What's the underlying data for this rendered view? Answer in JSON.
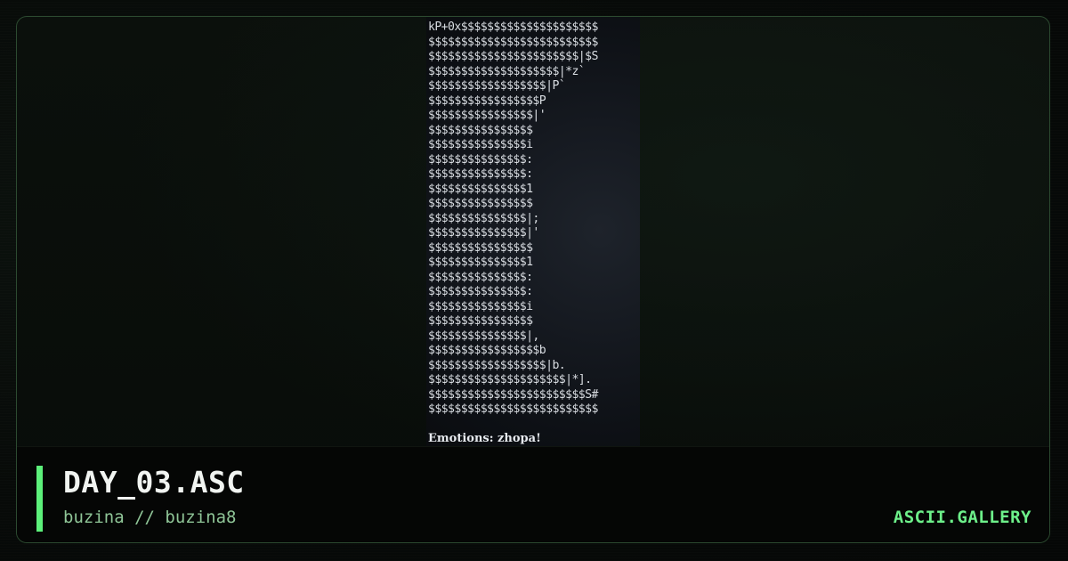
{
  "artwork": {
    "lines": [
      "kP+0x$$$$$$$$$$$$$$$$$$$$$",
      "$$$$$$$$$$$$$$$$$$$$$$$$$$",
      "$$$$$$$$$$$$$$$$$$$$$$$|$S",
      "$$$$$$$$$$$$$$$$$$$$|*z`  ",
      "$$$$$$$$$$$$$$$$$$|P`     ",
      "$$$$$$$$$$$$$$$$$P        ",
      "$$$$$$$$$$$$$$$$|'        ",
      "$$$$$$$$$$$$$$$$          ",
      "$$$$$$$$$$$$$$$i          ",
      "$$$$$$$$$$$$$$$:          ",
      "$$$$$$$$$$$$$$$:          ",
      "$$$$$$$$$$$$$$$1          ",
      "$$$$$$$$$$$$$$$$          ",
      "$$$$$$$$$$$$$$$|;         ",
      "$$$$$$$$$$$$$$$|'         ",
      "$$$$$$$$$$$$$$$$          ",
      "$$$$$$$$$$$$$$$1          ",
      "$$$$$$$$$$$$$$$:          ",
      "$$$$$$$$$$$$$$$:          ",
      "$$$$$$$$$$$$$$$i          ",
      "$$$$$$$$$$$$$$$$          ",
      "$$$$$$$$$$$$$$$|,         ",
      "$$$$$$$$$$$$$$$$$b        ",
      "$$$$$$$$$$$$$$$$$$|b.     ",
      "$$$$$$$$$$$$$$$$$$$$$|*].  ",
      "$$$$$$$$$$$$$$$$$$$$$$$$S#",
      "$$$$$$$$$$$$$$$$$$$$$$$$$$"
    ],
    "caption": "Emotions: zhopa!"
  },
  "info": {
    "title": "DAY_03.ASC",
    "byline": "buzina // buzina8",
    "brand": "ASCII.GALLERY"
  },
  "colors": {
    "accent": "#5cf07a",
    "brand": "#6df08a",
    "byline": "#8fc597",
    "card_border": "#2c4a30"
  }
}
